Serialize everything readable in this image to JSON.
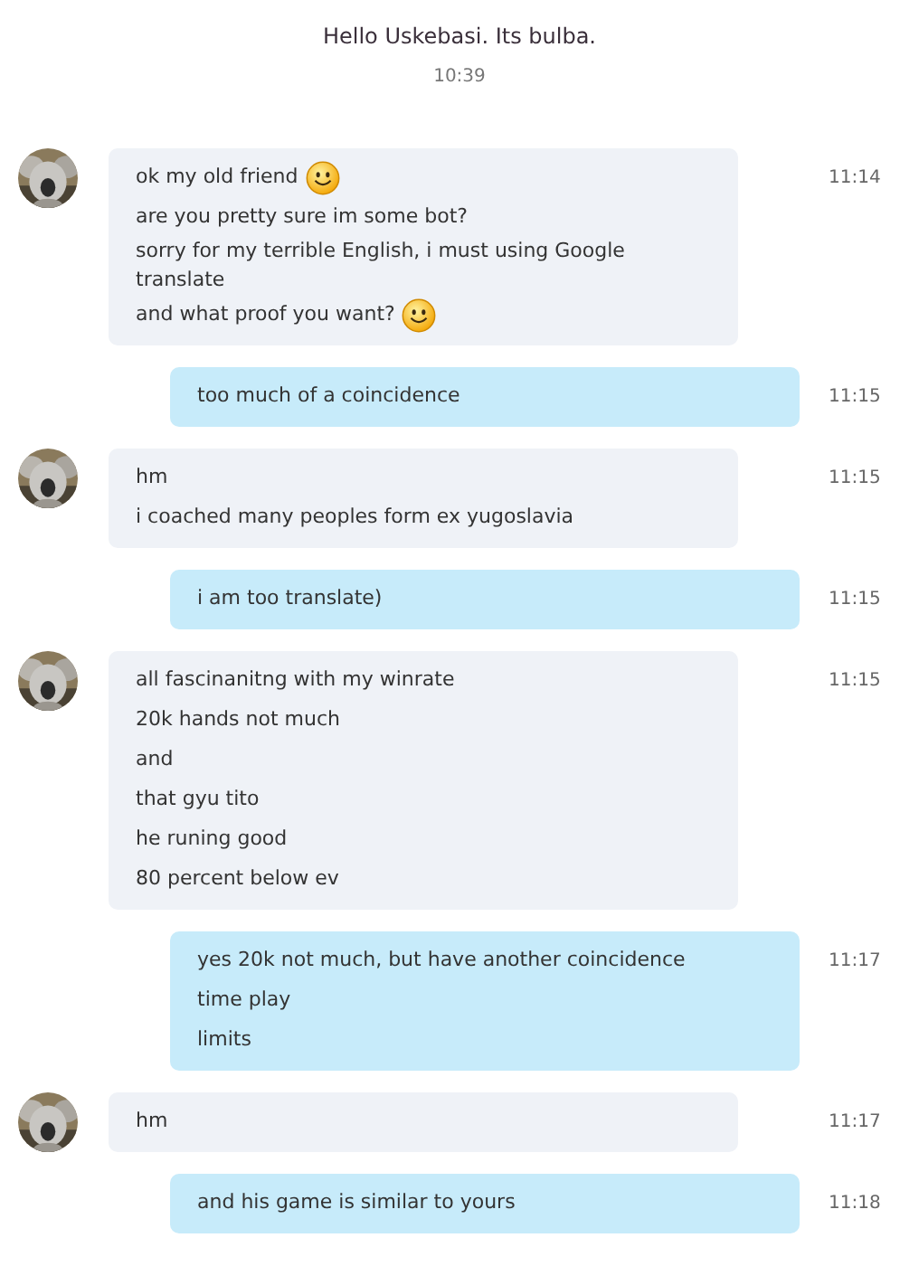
{
  "header": {
    "text": "Hello Uskebasi. Its bulba.",
    "time": "10:39"
  },
  "messages": [
    {
      "kind": "incoming",
      "time": "11:14",
      "lines": [
        {
          "text": "ok my old friend",
          "emoji": true
        },
        {
          "text": "are you pretty sure im some bot?",
          "emoji": false
        },
        {
          "text": "sorry for my terrible English, i must using Google translate",
          "emoji": false
        },
        {
          "text": "and what proof you want?",
          "emoji": true
        }
      ]
    },
    {
      "kind": "outgoing",
      "time": "11:15",
      "lines": [
        {
          "text": "too much of a coincidence",
          "emoji": false
        }
      ]
    },
    {
      "kind": "incoming",
      "time": "11:15",
      "lines": [
        {
          "text": "hm",
          "emoji": false
        },
        {
          "text": "i coached many peoples form ex yugoslavia",
          "emoji": false
        }
      ]
    },
    {
      "kind": "outgoing",
      "time": "11:15",
      "lines": [
        {
          "text": "i am too translate)",
          "emoji": false
        }
      ]
    },
    {
      "kind": "incoming",
      "time": "11:15",
      "lines": [
        {
          "text": "all fascinanitng with my winrate",
          "emoji": false
        },
        {
          "text": "20k hands not much",
          "emoji": false
        },
        {
          "text": "and",
          "emoji": false
        },
        {
          "text": "that gyu tito",
          "emoji": false
        },
        {
          "text": "he runing good",
          "emoji": false
        },
        {
          "text": "80 percent below ev",
          "emoji": false
        }
      ]
    },
    {
      "kind": "outgoing",
      "time": "11:17",
      "lines": [
        {
          "text": "yes 20k not much, but have another coincidence",
          "emoji": false
        },
        {
          "text": "time play",
          "emoji": false
        },
        {
          "text": "limits",
          "emoji": false
        }
      ]
    },
    {
      "kind": "incoming",
      "time": "11:17",
      "lines": [
        {
          "text": "hm",
          "emoji": false
        }
      ]
    },
    {
      "kind": "outgoing",
      "time": "11:18",
      "lines": [
        {
          "text": "and his game is similar to yours",
          "emoji": false
        }
      ]
    }
  ]
}
